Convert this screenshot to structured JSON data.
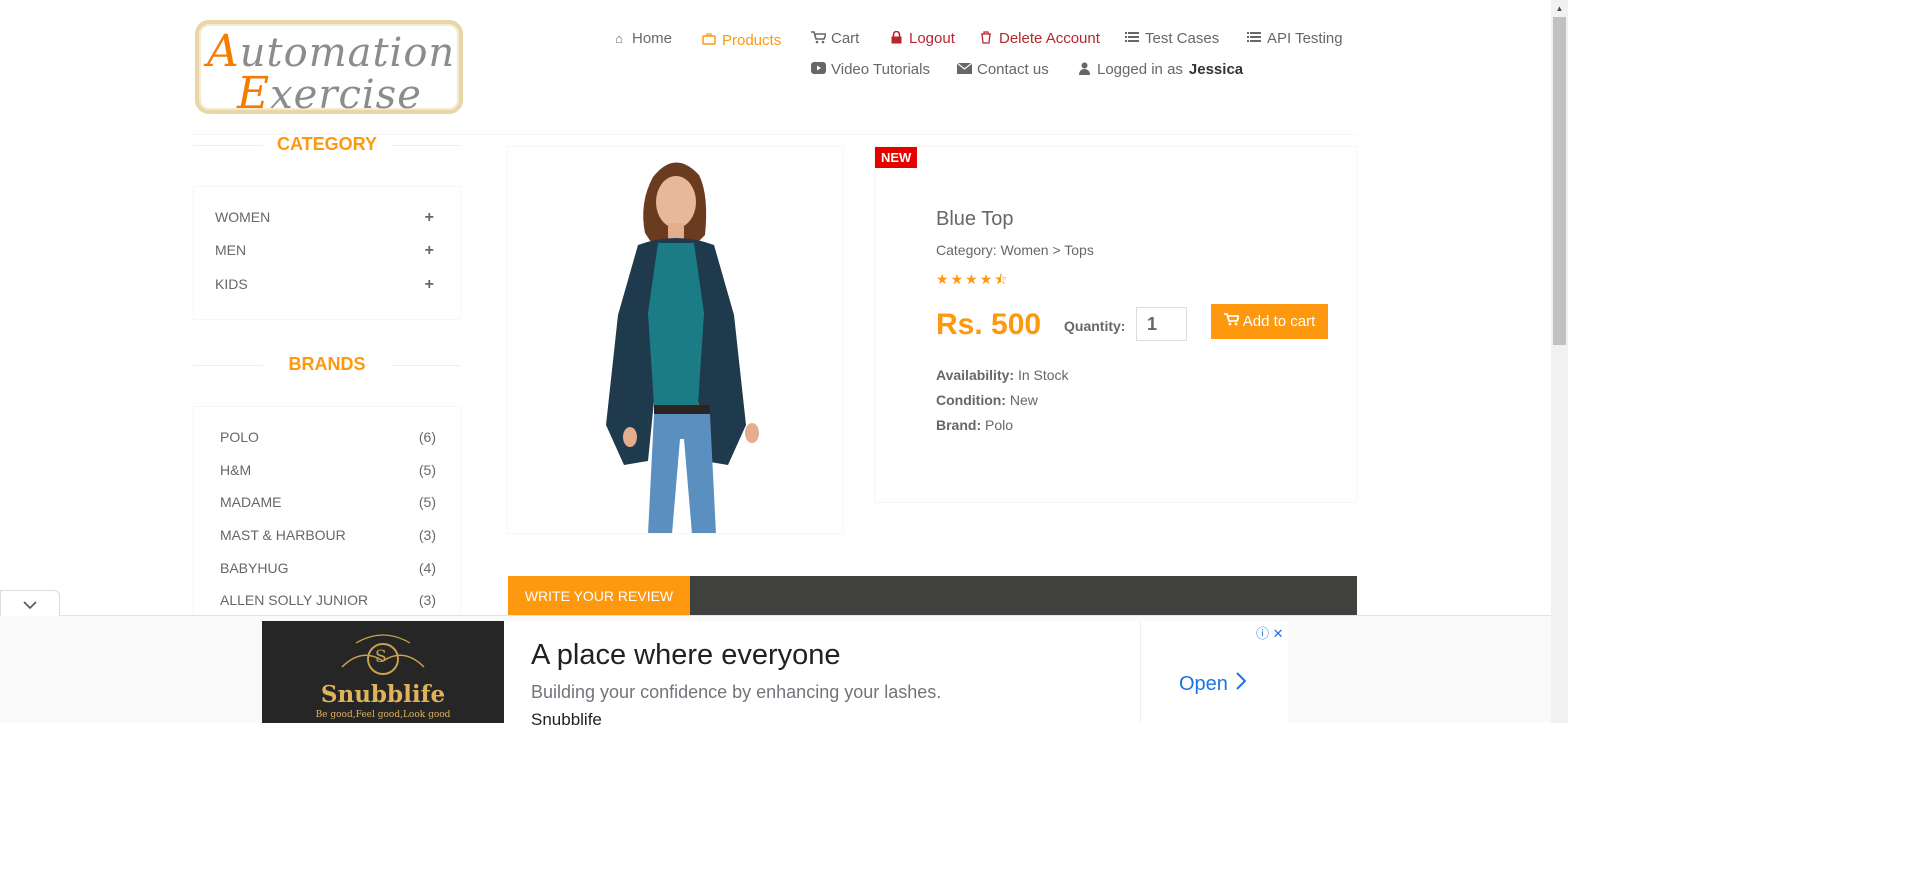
{
  "logo": {
    "line1_cap": "A",
    "line1_rest": "utomation",
    "line2_cap": "E",
    "line2_rest": "xercise"
  },
  "nav": {
    "home": "Home",
    "products": "Products",
    "cart": "Cart",
    "logout": "Logout",
    "delete_account": "Delete Account",
    "test_cases": "Test Cases",
    "api_testing": "API Testing",
    "video_tutorials": "Video Tutorials",
    "contact_us": "Contact us",
    "logged_in_as": "Logged in as",
    "username": "Jessica"
  },
  "sidebar": {
    "category_title": "CATEGORY",
    "categories": [
      {
        "label": "WOMEN",
        "icon": "plus-icon"
      },
      {
        "label": "MEN",
        "icon": "plus-icon"
      },
      {
        "label": "KIDS",
        "icon": "plus-icon"
      }
    ],
    "brands_title": "BRANDS",
    "brands": [
      {
        "name": "POLO",
        "count": "(6)"
      },
      {
        "name": "H&M",
        "count": "(5)"
      },
      {
        "name": "MADAME",
        "count": "(5)"
      },
      {
        "name": "MAST & HARBOUR",
        "count": "(3)"
      },
      {
        "name": "BABYHUG",
        "count": "(4)"
      },
      {
        "name": "ALLEN SOLLY JUNIOR",
        "count": "(3)"
      }
    ]
  },
  "product": {
    "badge": "NEW",
    "name": "Blue Top",
    "category": "Category: Women > Tops",
    "rating": 4.5,
    "price": "Rs. 500",
    "quantity_label": "Quantity:",
    "quantity_value": "1",
    "add_to_cart": "Add to cart",
    "availability_label": "Availability:",
    "availability": "In Stock",
    "condition_label": "Condition:",
    "condition": "New",
    "brand_label": "Brand:",
    "brand": "Polo"
  },
  "review": {
    "tab_label": "WRITE YOUR REVIEW"
  },
  "ad": {
    "brand_logo": "Snubblife",
    "brand_tagline": "Be good,Feel good,Look good",
    "title": "A place where everyone",
    "subtitle": "Building your confidence by enhancing your lashes.",
    "advertiser": "Snubblife",
    "cta": "Open"
  },
  "colors": {
    "accent": "#fe980f",
    "danger": "#b7262c",
    "text": "#696763",
    "new_badge": "#e60000"
  }
}
